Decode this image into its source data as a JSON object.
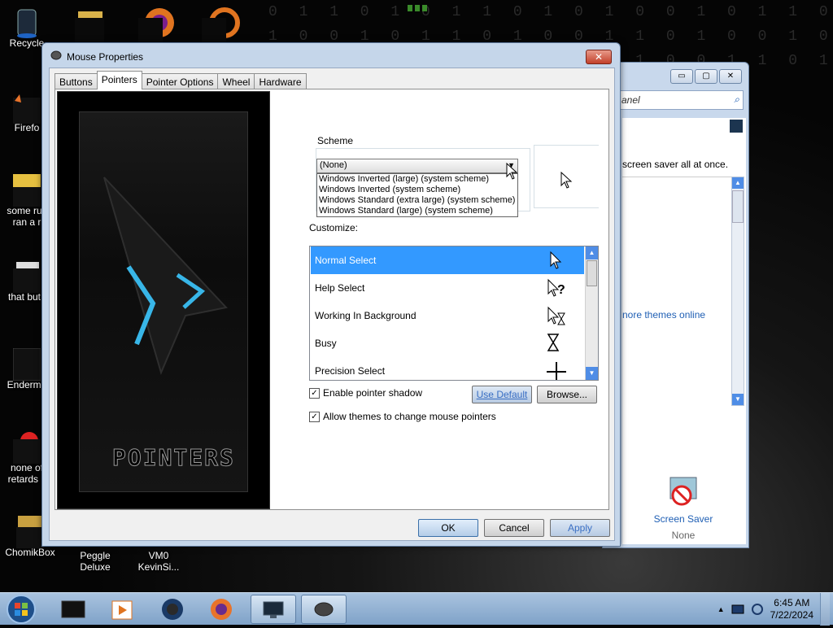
{
  "desktop": {
    "icons": [
      {
        "label": "Recycle"
      },
      {
        "label": "Firefo"
      },
      {
        "label": "some rus ran a r"
      },
      {
        "label": "that but i"
      },
      {
        "label": "Enderma"
      },
      {
        "label": "none of retards k"
      },
      {
        "label": "ChomikBox"
      },
      {
        "label": "Peggle Deluxe"
      },
      {
        "label": "VM0 KevinSi..."
      }
    ]
  },
  "control_panel": {
    "search_text": "anel",
    "screensaver_text": "screen saver all at once.",
    "more_themes_link": "nore themes online",
    "screen_saver_title": "Screen Saver",
    "screen_saver_value": "None"
  },
  "mouse_properties": {
    "title": "Mouse Properties",
    "tabs": [
      "Buttons",
      "Pointers",
      "Pointer Options",
      "Wheel",
      "Hardware"
    ],
    "active_tab": "Pointers",
    "theme_brand": "POINTERS",
    "scheme_label": "Scheme",
    "scheme_selected": "(None)",
    "scheme_options": [
      "Windows Inverted (large) (system scheme)",
      "Windows Inverted (system scheme)",
      "Windows Standard (extra large) (system scheme)",
      "Windows Standard (large) (system scheme)"
    ],
    "customize_label": "Customize:",
    "cursors": [
      {
        "label": "Normal Select",
        "icon": "arrow-cursor-icon",
        "selected": true
      },
      {
        "label": "Help Select",
        "icon": "help-cursor-icon",
        "selected": false
      },
      {
        "label": "Working In Background",
        "icon": "working-cursor-icon",
        "selected": false
      },
      {
        "label": "Busy",
        "icon": "hourglass-icon",
        "selected": false
      },
      {
        "label": "Precision Select",
        "icon": "crosshair-icon",
        "selected": false
      }
    ],
    "enable_shadow_label": "Enable pointer shadow",
    "enable_shadow_checked": true,
    "allow_themes_label": "Allow themes to change mouse pointers",
    "allow_themes_checked": true,
    "use_default_label": "Use Default",
    "browse_label": "Browse...",
    "ok_label": "OK",
    "cancel_label": "Cancel",
    "apply_label": "Apply"
  },
  "taskbar": {
    "time": "6:45 AM",
    "date": "7/22/2024"
  }
}
